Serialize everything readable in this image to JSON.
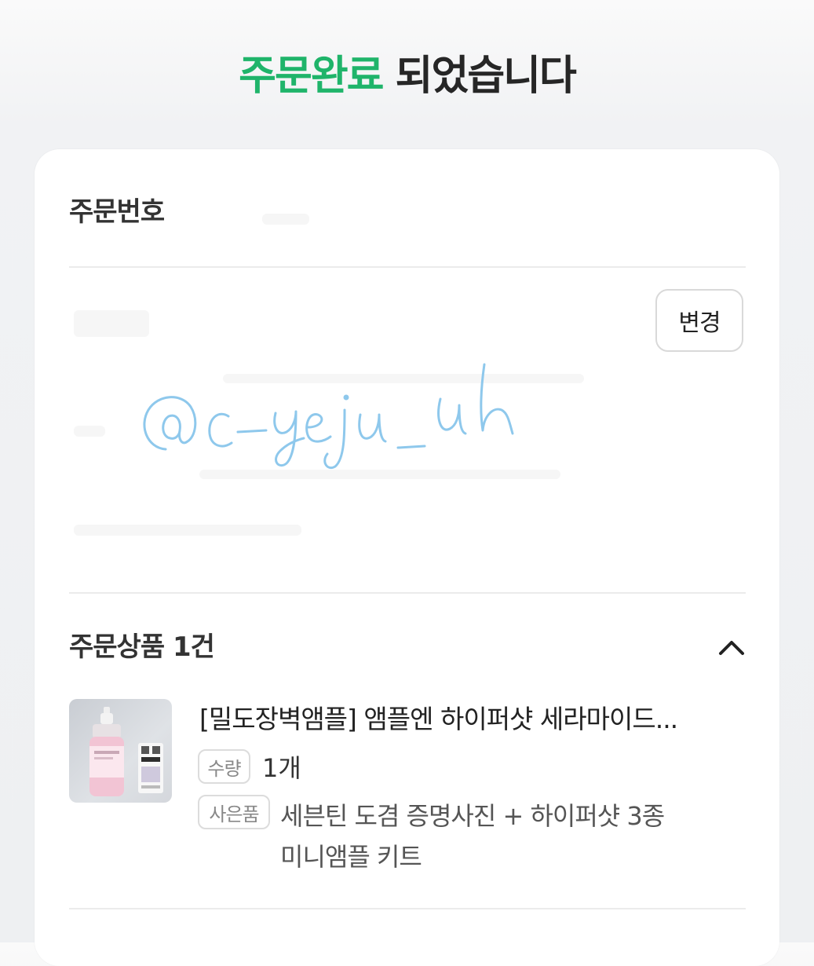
{
  "header": {
    "title_accent": "주문완료",
    "title_rest": " 되었습니다"
  },
  "order_number": {
    "label": "주문번호"
  },
  "shipping": {
    "change_button": "변경",
    "watermark_text": "@c-yeju_uh"
  },
  "products": {
    "section_title": "주문상품 1건",
    "items": [
      {
        "title": "[밀도장벽앰플] 앰플엔 하이퍼샷 세라마이드...",
        "qty_tag": "수량",
        "qty_value": "1개",
        "gift_tag": "사은품",
        "gift_text": "세븐틴 도겸 증명사진 + 하이퍼샷 3종 미니앰플 키트"
      }
    ]
  },
  "colors": {
    "accent": "#1fb46a",
    "watermark": "#8ec8ec"
  }
}
